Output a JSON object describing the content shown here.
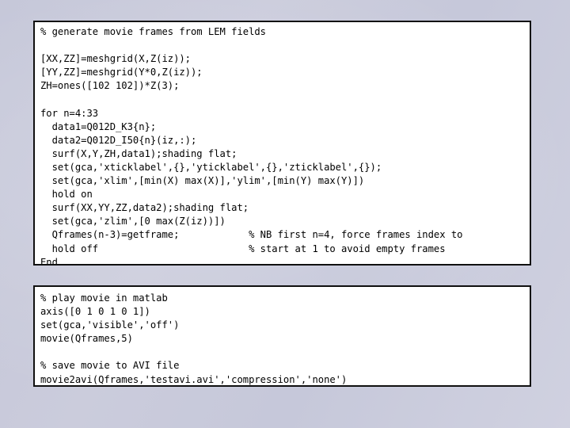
{
  "slide": {
    "background_color": "#c9cadb",
    "box_fill_color": "#ffffff",
    "box_border_color": "#101010",
    "text_color": "#000000"
  },
  "code_blocks": [
    {
      "name": "generate-movie-frames",
      "text": "% generate movie frames from LEM fields\n\n[XX,ZZ]=meshgrid(X,Z(iz));\n[YY,ZZ]=meshgrid(Y*0,Z(iz));\nZH=ones([102 102])*Z(3);\n\nfor n=4:33\n  data1=Q012D_K3{n};\n  data2=Q012D_I50{n}(iz,:);\n  surf(X,Y,ZH,data1);shading flat;\n  set(gca,'xticklabel',{},'yticklabel',{},'zticklabel',{});\n  set(gca,'xlim',[min(X) max(X)],'ylim',[min(Y) max(Y)])\n  hold on\n  surf(XX,YY,ZZ,data2);shading flat;\n  set(gca,'zlim',[0 max(Z(iz))])\n  Qframes(n-3)=getframe;            % NB first n=4, force frames index to\n  hold off                          % start at 1 to avoid empty frames\nEnd"
    },
    {
      "name": "play-and-save-movie",
      "text": "% play movie in matlab\naxis([0 1 0 1 0 1])\nset(gca,'visible','off')\nmovie(Qframes,5)\n\n% save movie to AVI file\nmovie2avi(Qframes,'testavi.avi','compression','none')"
    }
  ]
}
